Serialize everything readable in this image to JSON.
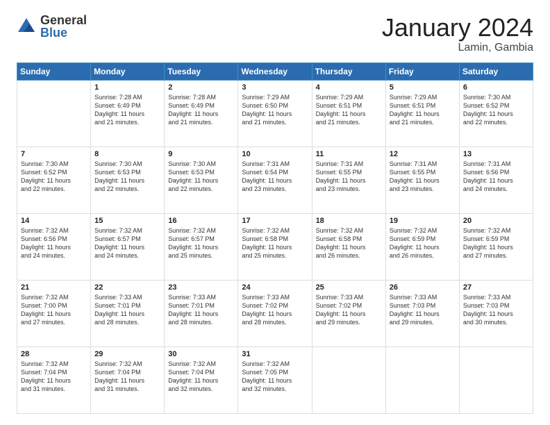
{
  "header": {
    "logo_general": "General",
    "logo_blue": "Blue",
    "title": "January 2024",
    "subtitle": "Lamin, Gambia"
  },
  "days_of_week": [
    "Sunday",
    "Monday",
    "Tuesday",
    "Wednesday",
    "Thursday",
    "Friday",
    "Saturday"
  ],
  "weeks": [
    [
      {
        "day": "",
        "info": ""
      },
      {
        "day": "1",
        "info": "Sunrise: 7:28 AM\nSunset: 6:49 PM\nDaylight: 11 hours\nand 21 minutes."
      },
      {
        "day": "2",
        "info": "Sunrise: 7:28 AM\nSunset: 6:49 PM\nDaylight: 11 hours\nand 21 minutes."
      },
      {
        "day": "3",
        "info": "Sunrise: 7:29 AM\nSunset: 6:50 PM\nDaylight: 11 hours\nand 21 minutes."
      },
      {
        "day": "4",
        "info": "Sunrise: 7:29 AM\nSunset: 6:51 PM\nDaylight: 11 hours\nand 21 minutes."
      },
      {
        "day": "5",
        "info": "Sunrise: 7:29 AM\nSunset: 6:51 PM\nDaylight: 11 hours\nand 21 minutes."
      },
      {
        "day": "6",
        "info": "Sunrise: 7:30 AM\nSunset: 6:52 PM\nDaylight: 11 hours\nand 22 minutes."
      }
    ],
    [
      {
        "day": "7",
        "info": "Sunrise: 7:30 AM\nSunset: 6:52 PM\nDaylight: 11 hours\nand 22 minutes."
      },
      {
        "day": "8",
        "info": "Sunrise: 7:30 AM\nSunset: 6:53 PM\nDaylight: 11 hours\nand 22 minutes."
      },
      {
        "day": "9",
        "info": "Sunrise: 7:30 AM\nSunset: 6:53 PM\nDaylight: 11 hours\nand 22 minutes."
      },
      {
        "day": "10",
        "info": "Sunrise: 7:31 AM\nSunset: 6:54 PM\nDaylight: 11 hours\nand 23 minutes."
      },
      {
        "day": "11",
        "info": "Sunrise: 7:31 AM\nSunset: 6:55 PM\nDaylight: 11 hours\nand 23 minutes."
      },
      {
        "day": "12",
        "info": "Sunrise: 7:31 AM\nSunset: 6:55 PM\nDaylight: 11 hours\nand 23 minutes."
      },
      {
        "day": "13",
        "info": "Sunrise: 7:31 AM\nSunset: 6:56 PM\nDaylight: 11 hours\nand 24 minutes."
      }
    ],
    [
      {
        "day": "14",
        "info": "Sunrise: 7:32 AM\nSunset: 6:56 PM\nDaylight: 11 hours\nand 24 minutes."
      },
      {
        "day": "15",
        "info": "Sunrise: 7:32 AM\nSunset: 6:57 PM\nDaylight: 11 hours\nand 24 minutes."
      },
      {
        "day": "16",
        "info": "Sunrise: 7:32 AM\nSunset: 6:57 PM\nDaylight: 11 hours\nand 25 minutes."
      },
      {
        "day": "17",
        "info": "Sunrise: 7:32 AM\nSunset: 6:58 PM\nDaylight: 11 hours\nand 25 minutes."
      },
      {
        "day": "18",
        "info": "Sunrise: 7:32 AM\nSunset: 6:58 PM\nDaylight: 11 hours\nand 26 minutes."
      },
      {
        "day": "19",
        "info": "Sunrise: 7:32 AM\nSunset: 6:59 PM\nDaylight: 11 hours\nand 26 minutes."
      },
      {
        "day": "20",
        "info": "Sunrise: 7:32 AM\nSunset: 6:59 PM\nDaylight: 11 hours\nand 27 minutes."
      }
    ],
    [
      {
        "day": "21",
        "info": "Sunrise: 7:32 AM\nSunset: 7:00 PM\nDaylight: 11 hours\nand 27 minutes."
      },
      {
        "day": "22",
        "info": "Sunrise: 7:33 AM\nSunset: 7:01 PM\nDaylight: 11 hours\nand 28 minutes."
      },
      {
        "day": "23",
        "info": "Sunrise: 7:33 AM\nSunset: 7:01 PM\nDaylight: 11 hours\nand 28 minutes."
      },
      {
        "day": "24",
        "info": "Sunrise: 7:33 AM\nSunset: 7:02 PM\nDaylight: 11 hours\nand 28 minutes."
      },
      {
        "day": "25",
        "info": "Sunrise: 7:33 AM\nSunset: 7:02 PM\nDaylight: 11 hours\nand 29 minutes."
      },
      {
        "day": "26",
        "info": "Sunrise: 7:33 AM\nSunset: 7:03 PM\nDaylight: 11 hours\nand 29 minutes."
      },
      {
        "day": "27",
        "info": "Sunrise: 7:33 AM\nSunset: 7:03 PM\nDaylight: 11 hours\nand 30 minutes."
      }
    ],
    [
      {
        "day": "28",
        "info": "Sunrise: 7:32 AM\nSunset: 7:04 PM\nDaylight: 11 hours\nand 31 minutes."
      },
      {
        "day": "29",
        "info": "Sunrise: 7:32 AM\nSunset: 7:04 PM\nDaylight: 11 hours\nand 31 minutes."
      },
      {
        "day": "30",
        "info": "Sunrise: 7:32 AM\nSunset: 7:04 PM\nDaylight: 11 hours\nand 32 minutes."
      },
      {
        "day": "31",
        "info": "Sunrise: 7:32 AM\nSunset: 7:05 PM\nDaylight: 11 hours\nand 32 minutes."
      },
      {
        "day": "",
        "info": ""
      },
      {
        "day": "",
        "info": ""
      },
      {
        "day": "",
        "info": ""
      }
    ]
  ]
}
